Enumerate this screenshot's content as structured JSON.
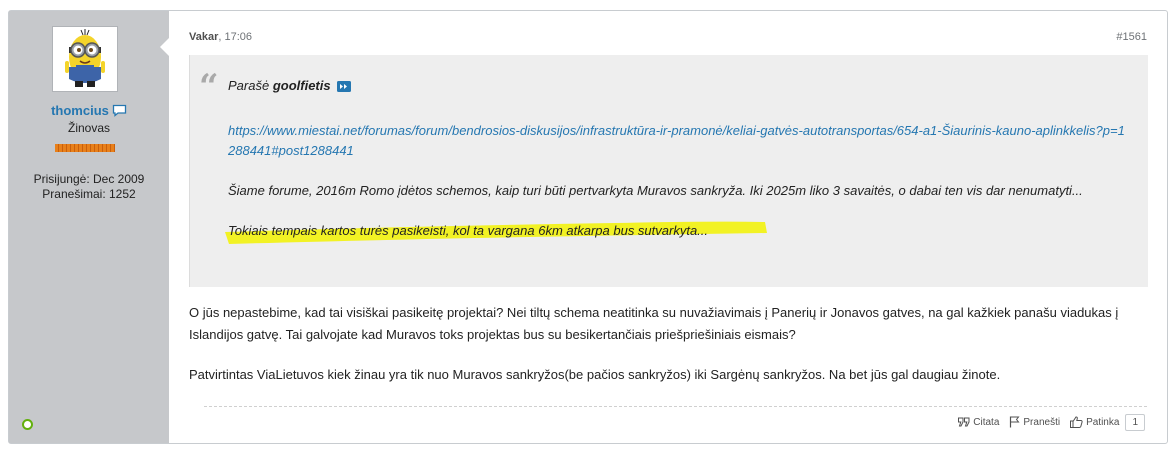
{
  "user": {
    "name": "thomcius",
    "title": "Žinovas",
    "joined": "Prisijungė: Dec 2009",
    "posts": "Pranešimai: 1252"
  },
  "post": {
    "date_day": "Vakar",
    "date_time": ", 17:06",
    "number": "#1561"
  },
  "quote": {
    "prefix": "Parašė ",
    "author": "goolfietis",
    "link": "https://www.miestai.net/forumas/forum/bendrosios-diskusijos/infrastruktūra-ir-pramonė/keliai-gatvės-autotransportas/654-a1-Šiaurinis-kauno-aplinkkelis?p=1288441#post1288441",
    "para1": "Šiame forume, 2016m Romo įdėtos schemos, kaip turi būti pertvarkyta Muravos sankryža. Iki 2025m liko 3 savaitės, o dabai ten vis dar nenumatyti...",
    "para2": "Tokiais tempais kartos turės pasikeisti, kol ta vargana 6km atkarpa bus sutvarkyta..."
  },
  "message": {
    "para1": "O jūs nepastebime, kad tai visiškai pasikeitę projektai? Nei tiltų schema neatitinka su nuvažiavimais į Panerių ir Jonavos gatves, na gal kažkiek panašu viadukas į Islandijos gatvę. Tai galvojate kad Muravos toks projektas bus su besikertančiais priešpriešiniais eismais?",
    "para2": "Patvirtintas ViaLietuvos kiek žinau yra tik nuo Muravos sankryžos(be pačios sankryžos) iki Sargėnų sankryžos. Na bet jūs gal daugiau žinote."
  },
  "actions": {
    "quote_label": "Citata",
    "report_label": "Pranešti",
    "like_label": "Patinka",
    "like_count": "1"
  },
  "colors": {
    "sidebar_bg": "#c6c8cb",
    "link": "#2577b1",
    "quote_bg": "#eeeeee",
    "highlight": "#f2f200",
    "online": "#63b00d"
  },
  "icons": [
    "minion-avatar",
    "chat-bubble-icon",
    "quote-mark-icon",
    "jump-to-post-icon",
    "quote-icon",
    "flag-icon",
    "thumbs-up-icon",
    "online-status-icon"
  ]
}
